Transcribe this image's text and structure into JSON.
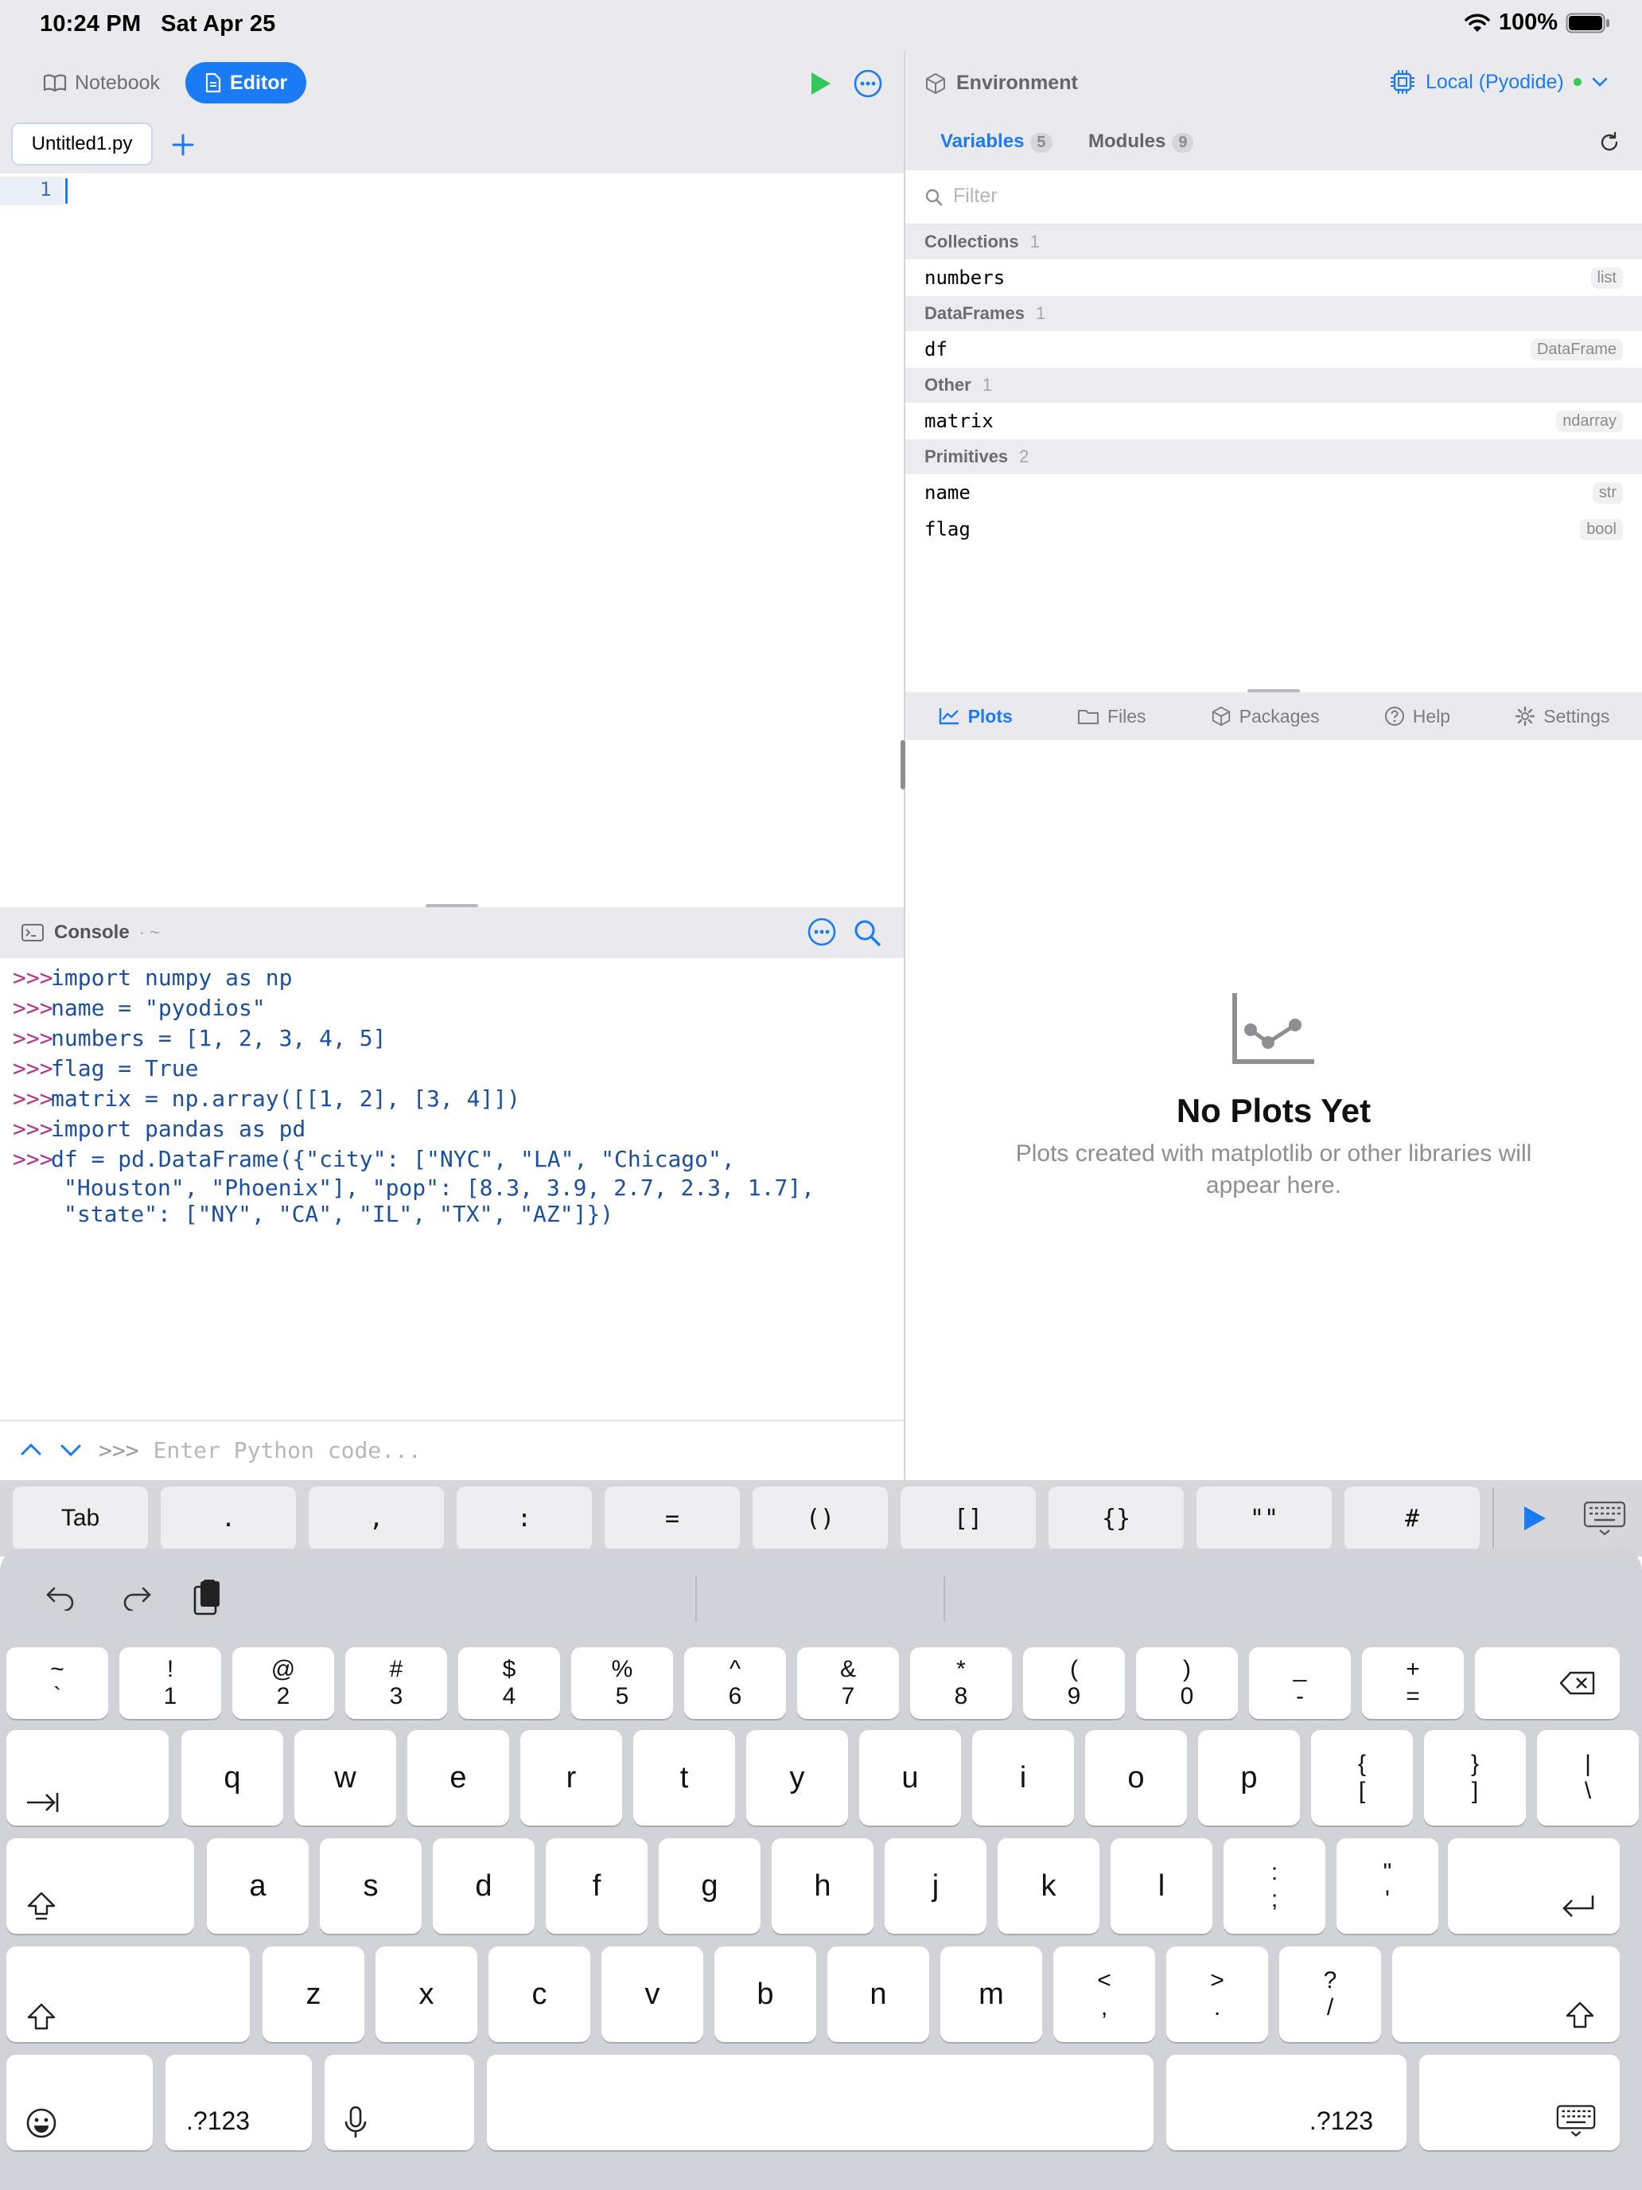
{
  "status": {
    "time": "10:24 PM",
    "date": "Sat Apr 25",
    "battery": "100%"
  },
  "editor_bar": {
    "notebook_label": "Notebook",
    "editor_label": "Editor"
  },
  "file_tab": {
    "name": "Untitled1.py"
  },
  "editor": {
    "line_number": "1"
  },
  "console": {
    "title": "Console",
    "path": "· ~",
    "prompt": ">>>",
    "lines": [
      "import numpy as np",
      "name = \"pyodios\"",
      "numbers = [1, 2, 3, 4, 5]",
      "flag = True",
      "matrix = np.array([[1, 2], [3, 4]])",
      "import pandas as pd",
      "df = pd.DataFrame({\"city\": [\"NYC\", \"LA\", \"Chicago\","
    ],
    "continuation": [
      "\"Houston\", \"Phoenix\"], \"pop\": [8.3, 3.9, 2.7, 2.3, 1.7],",
      "\"state\": [\"NY\", \"CA\", \"IL\", \"TX\", \"AZ\"]})"
    ],
    "input_placeholder": "Enter Python code..."
  },
  "accessory_keys": [
    "Tab",
    ".",
    ",",
    ":",
    "=",
    "()",
    "[]",
    "{}",
    "\"\"",
    "#"
  ],
  "environment": {
    "title": "Environment",
    "runtime": "Local (Pyodide)"
  },
  "var_tabs": {
    "variables": "Variables",
    "variables_count": "5",
    "modules": "Modules",
    "modules_count": "9"
  },
  "filter_placeholder": "Filter",
  "groups": [
    {
      "name": "Collections",
      "count": "1",
      "items": [
        {
          "name": "numbers",
          "type": "list"
        }
      ]
    },
    {
      "name": "DataFrames",
      "count": "1",
      "items": [
        {
          "name": "df",
          "type": "DataFrame"
        }
      ]
    },
    {
      "name": "Other",
      "count": "1",
      "items": [
        {
          "name": "matrix",
          "type": "ndarray"
        }
      ]
    },
    {
      "name": "Primitives",
      "count": "2",
      "items": [
        {
          "name": "name",
          "type": "str"
        },
        {
          "name": "flag",
          "type": "bool"
        }
      ]
    }
  ],
  "bottom_tabs": [
    "Plots",
    "Files",
    "Packages",
    "Help",
    "Settings"
  ],
  "plots_empty": {
    "title": "No Plots Yet",
    "message_1": "Plots created with matplotlib or other libraries will",
    "message_2": "appear here."
  },
  "keyboard": {
    "row1": [
      [
        "~",
        "`"
      ],
      [
        "!",
        "1"
      ],
      [
        "@",
        "2"
      ],
      [
        "#",
        "3"
      ],
      [
        "$",
        "4"
      ],
      [
        "%",
        "5"
      ],
      [
        "^",
        "6"
      ],
      [
        "&",
        "7"
      ],
      [
        "*",
        "8"
      ],
      [
        "(",
        "9"
      ],
      [
        ")",
        "0"
      ],
      [
        "_",
        "-"
      ],
      [
        "+",
        "="
      ]
    ],
    "row2": [
      "q",
      "w",
      "e",
      "r",
      "t",
      "y",
      "u",
      "i",
      "o",
      "p"
    ],
    "row2_extra": [
      [
        "{",
        "["
      ],
      [
        "}",
        "]"
      ],
      [
        "|",
        "\\"
      ]
    ],
    "row3": [
      "a",
      "s",
      "d",
      "f",
      "g",
      "h",
      "j",
      "k",
      "l"
    ],
    "row3_extra": [
      [
        ":",
        ";"
      ],
      [
        "\"",
        "'"
      ]
    ],
    "row4": [
      "z",
      "x",
      "c",
      "v",
      "b",
      "n",
      "m"
    ],
    "row4_extra": [
      [
        "<",
        ","
      ],
      [
        ">",
        "."
      ],
      [
        "?",
        "/"
      ]
    ],
    "numbers_label": ".?123"
  },
  "colors": {
    "accent": "#1a7cf5",
    "run_green": "#34c759",
    "prompt": "#b5338a",
    "code": "#1b4fa0"
  }
}
